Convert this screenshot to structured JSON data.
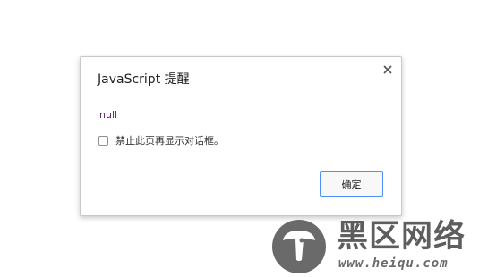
{
  "dialog": {
    "title": "JavaScript 提醒",
    "close_icon": "close-icon",
    "message": "null",
    "checkbox_label": "禁止此页再显示对话框。",
    "checkbox_checked": false,
    "ok_label": "确定",
    "accent_color": "#4d90fe"
  },
  "watermark": {
    "logo": "mushroom-logo",
    "title": "黑区网络",
    "url": "www.heiqu.com"
  }
}
